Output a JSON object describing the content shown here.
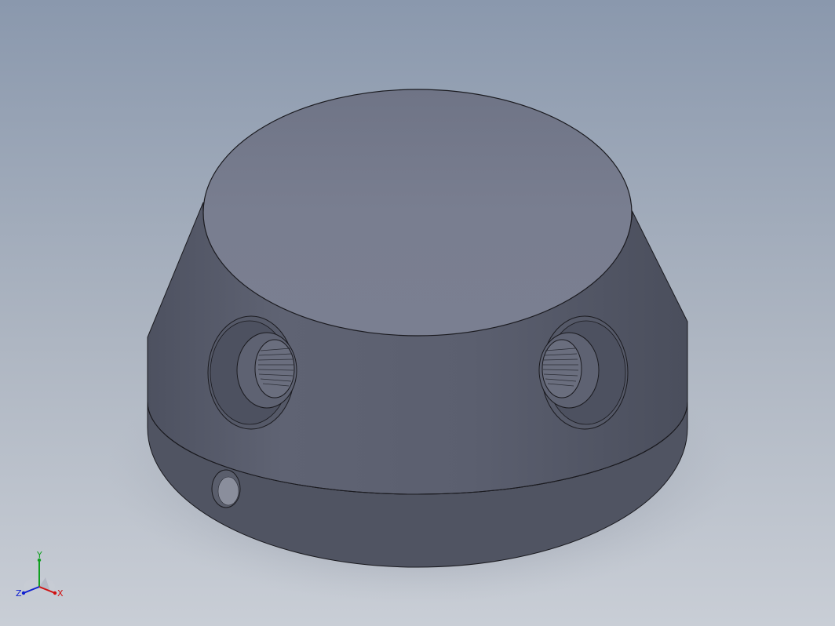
{
  "viewport": {
    "background_top": "#8a98ad",
    "background_bottom": "#c9ced6"
  },
  "model": {
    "part_color": "#5a5f6e",
    "top_face_color": "#777c8e",
    "edge_color": "#1a1a1f",
    "features": [
      "top-face",
      "tapered-wall",
      "lower-flange",
      "counterbored-hole-left",
      "counterbored-hole-right",
      "pin-hole"
    ]
  },
  "triad": {
    "x_label": "X",
    "y_label": "Y",
    "z_label": "Z",
    "x_color": "#d01010",
    "y_color": "#10a020",
    "z_color": "#1020d0"
  }
}
